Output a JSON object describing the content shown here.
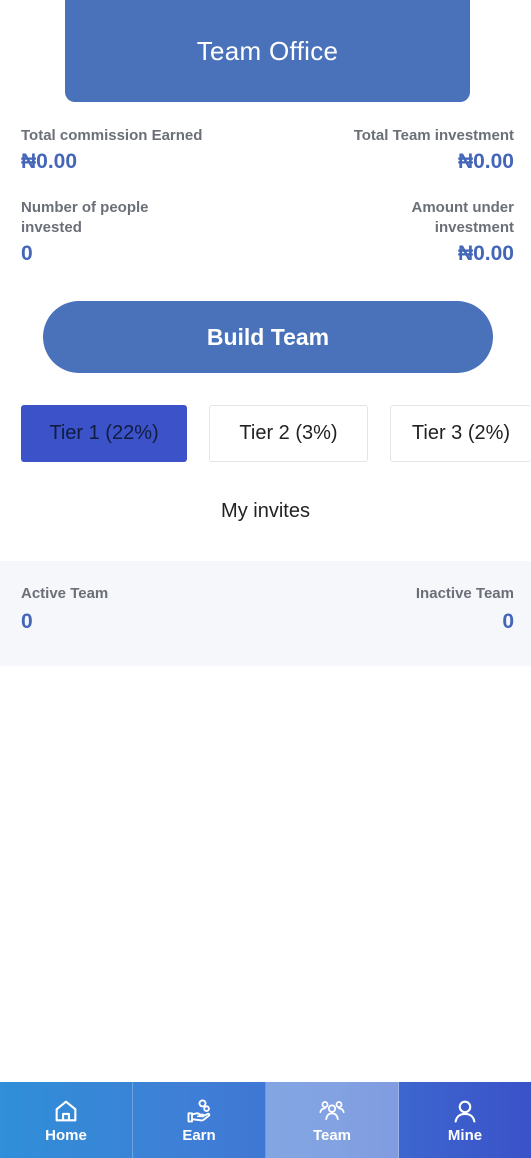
{
  "header": {
    "title": "Team Office"
  },
  "stats": {
    "total_commission_label": "Total commission Earned",
    "total_commission_value": "₦0.00",
    "total_team_investment_label": "Total Team investment",
    "total_team_investment_value": "₦0.00",
    "people_invested_label_line1": "Number of people",
    "people_invested_label_line2": "invested",
    "people_invested_value": "0",
    "amount_under_label_line1": "Amount under",
    "amount_under_label_line2": "investment",
    "amount_under_value": "₦0.00"
  },
  "build_team": {
    "label": "Build Team"
  },
  "tiers": [
    {
      "label": "Tier 1 (22%)",
      "active": true
    },
    {
      "label": "Tier 2 (3%)",
      "active": false
    },
    {
      "label": "Tier 3 (2%)",
      "active": false
    }
  ],
  "invites": {
    "title": "My invites"
  },
  "team": {
    "active_label": "Active Team",
    "active_value": "0",
    "inactive_label": "Inactive Team",
    "inactive_value": "0"
  },
  "nav": {
    "items": [
      {
        "label": "Home",
        "icon": "home-icon"
      },
      {
        "label": "Earn",
        "icon": "earn-hand-coin-icon"
      },
      {
        "label": "Team",
        "icon": "team-icon"
      },
      {
        "label": "Mine",
        "icon": "user-icon"
      }
    ],
    "active_index": 2
  },
  "colors": {
    "primary": "#4a72bb",
    "active_tier": "#3c52c8",
    "value_text": "#4466b8"
  }
}
